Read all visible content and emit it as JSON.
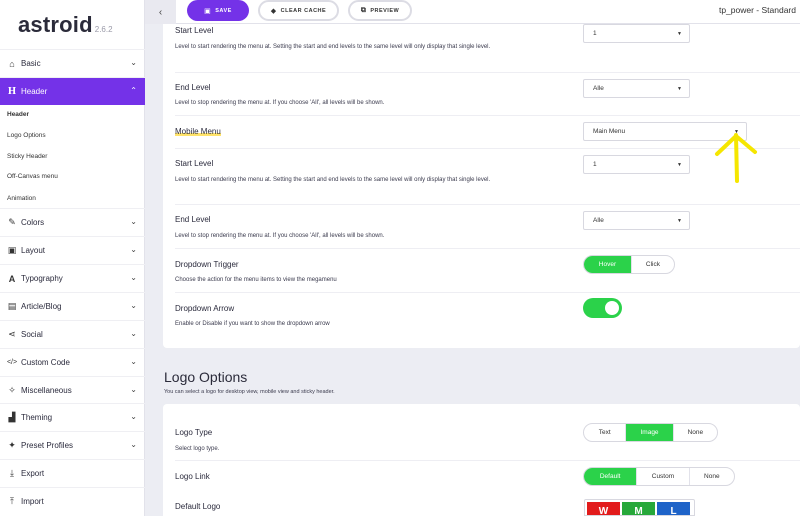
{
  "brand": {
    "name": "astroid",
    "version": "2.6.2"
  },
  "sidebar": {
    "items": [
      {
        "label": "Basic",
        "icon": "home-icon"
      },
      {
        "label": "Header",
        "icon": "header-h-icon"
      },
      {
        "label": "Colors",
        "icon": "brush-icon"
      },
      {
        "label": "Layout",
        "icon": "layout-icon"
      },
      {
        "label": "Typography",
        "icon": "font-icon"
      },
      {
        "label": "Article/Blog",
        "icon": "newspaper-icon"
      },
      {
        "label": "Social",
        "icon": "share-icon"
      },
      {
        "label": "Custom Code",
        "icon": "code-icon"
      },
      {
        "label": "Miscellaneous",
        "icon": "satellite-icon"
      },
      {
        "label": "Theming",
        "icon": "paint-roller-icon"
      },
      {
        "label": "Preset Profiles",
        "icon": "magic-icon"
      },
      {
        "label": "Export",
        "icon": "download-icon"
      },
      {
        "label": "Import",
        "icon": "upload-icon"
      }
    ],
    "header_subitems": [
      "Header",
      "Logo Options",
      "Sticky Header",
      "Off-Canvas menu",
      "Animation"
    ]
  },
  "toolbar": {
    "save_label": "SAVE",
    "clear_cache_label": "CLEAR CACHE",
    "preview_label": "PREVIEW",
    "template_name": "tp_power - Standard"
  },
  "header_settings": {
    "start_level_1": {
      "title": "Start Level",
      "desc": "Level to start rendering the menu at. Setting the start and end levels to the same level will only display that single level.",
      "value": "1"
    },
    "end_level_1": {
      "title": "End Level",
      "desc": "Level to stop rendering the menu at. If you choose 'All', all levels will be shown.",
      "value": "Alle"
    },
    "mobile_menu": {
      "title": "Mobile Menu",
      "value": "Main Menu"
    },
    "start_level_2": {
      "title": "Start Level",
      "desc": "Level to start rendering the menu at. Setting the start and end levels to the same level will only display that single level.",
      "value": "1"
    },
    "end_level_2": {
      "title": "End Level",
      "desc": "Level to stop rendering the menu at. If you choose 'All', all levels will be shown.",
      "value": "Alle"
    },
    "dropdown_trigger": {
      "title": "Dropdown Trigger",
      "desc": "Choose the action for the menu items to view the megamenu",
      "options": [
        "Hover",
        "Click"
      ],
      "selected": "Hover"
    },
    "dropdown_arrow": {
      "title": "Dropdown Arrow",
      "desc": "Enable or Disable if you want to show the dropdown arrow",
      "enabled": true
    }
  },
  "logo_options": {
    "section_title": "Logo Options",
    "section_desc": "You can select a logo for desktop view, mobile view and sticky header.",
    "logo_type": {
      "title": "Logo Type",
      "desc": "Select logo type.",
      "options": [
        "Text",
        "Image",
        "None"
      ],
      "selected": "Image"
    },
    "logo_link": {
      "title": "Logo Link",
      "options": [
        "Default",
        "Custom",
        "None"
      ],
      "selected": "Default"
    },
    "default_logo": {
      "title": "Default Logo",
      "letters": [
        "W",
        "M",
        "L"
      ],
      "colors": [
        "#e21b1b",
        "#27a83a",
        "#1e63c8"
      ]
    }
  },
  "colors": {
    "accent": "#7432e8",
    "toggle_on": "#2bd24a",
    "annotation": "#f5e600"
  }
}
